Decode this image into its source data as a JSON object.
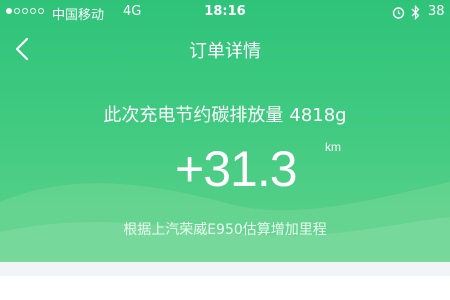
{
  "status_bar": {
    "carrier": "中国移动",
    "network": "4G",
    "time": "18:16",
    "battery": "38"
  },
  "nav": {
    "title": "订单详情",
    "back_icon": "chevron-left-icon"
  },
  "summary": {
    "carbon_label": "此次充电节约碳排放量",
    "carbon_value": "4818g",
    "mileage_value": "+31.3",
    "mileage_unit": "km",
    "note": "根据上汽荣威E950估算增加里程"
  },
  "colors": {
    "header_green": "#3fca80",
    "divider": "#f3f4f6"
  }
}
